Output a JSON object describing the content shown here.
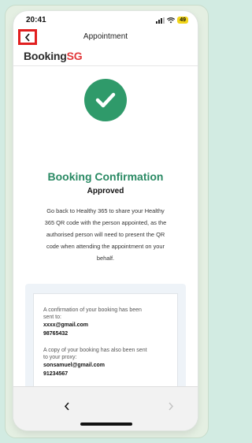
{
  "status_bar": {
    "time": "20:41",
    "battery": "49",
    "battery_color": "#f2d51a"
  },
  "nav": {
    "title": "Appointment",
    "back_icon": "chevron-left-icon",
    "highlight_color": "#e11f1f"
  },
  "brand": {
    "part1": "Booking",
    "part2": "SG",
    "part2_color": "#e2383a"
  },
  "confirmation": {
    "icon": "checkmark-icon",
    "icon_color": "#2f9a6a",
    "title": "Booking Confirmation",
    "status": "Approved",
    "description_lines": [
      "Go back to Healthy 365 to share your Healthy",
      "365 QR code with the person appointed, as the",
      "authorised person will need to present the QR",
      "code when attending the appointment on your",
      "behalf."
    ]
  },
  "details": {
    "sent_label_lines": [
      "A confirmation of your booking has been",
      "sent to:"
    ],
    "sent_email": "xxxx@gmail.com",
    "sent_phone": "98765432",
    "proxy_label_lines": [
      "A copy of your booking has also been sent",
      "to your proxy:"
    ],
    "proxy_email": "sonsamuel@gmail.com",
    "proxy_phone": "91234567"
  },
  "bottom_bar": {
    "prev_icon": "chevron-left-icon",
    "next_icon": "chevron-right-icon"
  }
}
